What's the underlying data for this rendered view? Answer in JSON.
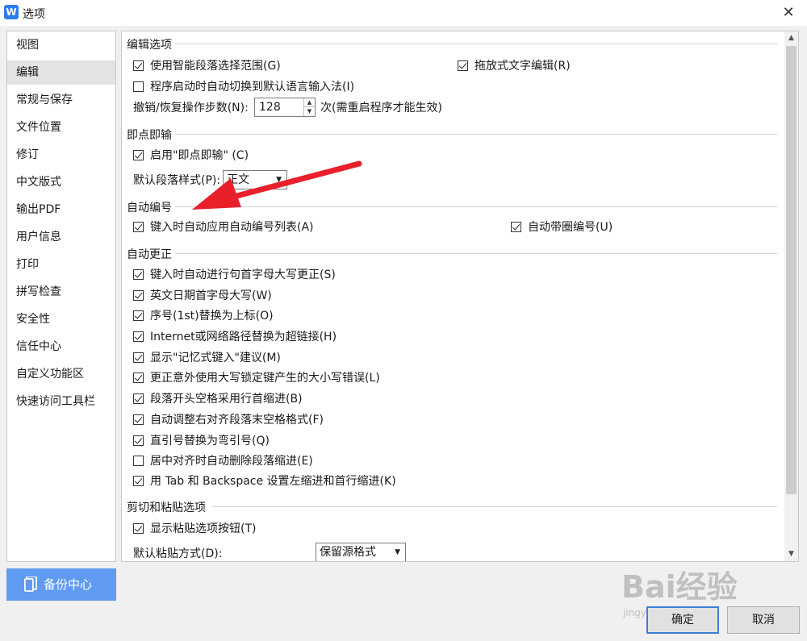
{
  "window": {
    "title": "选项",
    "app_icon_glyph": "W"
  },
  "sidebar": {
    "items": [
      {
        "label": "视图"
      },
      {
        "label": "编辑"
      },
      {
        "label": "常规与保存"
      },
      {
        "label": "文件位置"
      },
      {
        "label": "修订"
      },
      {
        "label": "中文版式"
      },
      {
        "label": "输出PDF"
      },
      {
        "label": "用户信息"
      },
      {
        "label": "打印"
      },
      {
        "label": "拼写检查"
      },
      {
        "label": "安全性"
      },
      {
        "label": "信任中心"
      },
      {
        "label": "自定义功能区"
      },
      {
        "label": "快速访问工具栏"
      }
    ],
    "active": "编辑"
  },
  "backup": {
    "label": "备份中心"
  },
  "sections": {
    "edit_options": {
      "title": "编辑选项",
      "smart_para": {
        "label": "使用智能段落选择范围(G)",
        "checked": true
      },
      "drag_text": {
        "label": "拖放式文字编辑(R)",
        "checked": true
      },
      "auto_ime": {
        "label": "程序启动时自动切换到默认语言输入法(I)",
        "checked": false
      },
      "undo_label": "撤销/恢复操作步数(N):",
      "undo_value": "128",
      "undo_note": "次(需重启程序才能生效)"
    },
    "click_type": {
      "title": "即点即输",
      "enable": {
        "label": "启用\"即点即输\" (C)",
        "checked": true
      },
      "para_style_label": "默认段落样式(P):",
      "para_style_value": "正文"
    },
    "auto_number": {
      "title": "自动编号",
      "auto_list": {
        "label": "键入时自动应用自动编号列表(A)",
        "checked": true
      },
      "circle_number": {
        "label": "自动带圈编号(U)",
        "checked": true
      }
    },
    "autocorrect": {
      "title": "自动更正",
      "items": [
        {
          "label": "键入时自动进行句首字母大写更正(S)",
          "checked": true
        },
        {
          "label": "英文日期首字母大写(W)",
          "checked": true
        },
        {
          "label": "序号(1st)替换为上标(O)",
          "checked": true
        },
        {
          "label": "Internet或网络路径替换为超链接(H)",
          "checked": true
        },
        {
          "label": "显示\"记忆式键入\"建议(M)",
          "checked": true
        },
        {
          "label": "更正意外使用大写锁定键产生的大小写错误(L)",
          "checked": true
        },
        {
          "label": "段落开头空格采用行首缩进(B)",
          "checked": true
        },
        {
          "label": "自动调整右对齐段落末空格格式(F)",
          "checked": true
        },
        {
          "label": "直引号替换为弯引号(Q)",
          "checked": true
        },
        {
          "label": "居中对齐时自动删除段落缩进(E)",
          "checked": false
        },
        {
          "label": "用 Tab 和 Backspace 设置左缩进和首行缩进(K)",
          "checked": true
        }
      ]
    },
    "paste": {
      "title": "剪切和粘贴选项",
      "show_paste_btn": {
        "label": "显示粘贴选项按钮(T)",
        "checked": true
      },
      "default_paste_label": "默认粘贴方式(D):",
      "default_paste_value": "保留源格式"
    }
  },
  "buttons": {
    "ok": "确定",
    "cancel": "取消"
  },
  "watermark": {
    "text": "Bai经验",
    "url": "jingyan.baidu.com"
  },
  "colors": {
    "accent": "#5f9bf1",
    "annotation_arrow": "#e8202a",
    "focus_border": "#3c7fd6"
  }
}
